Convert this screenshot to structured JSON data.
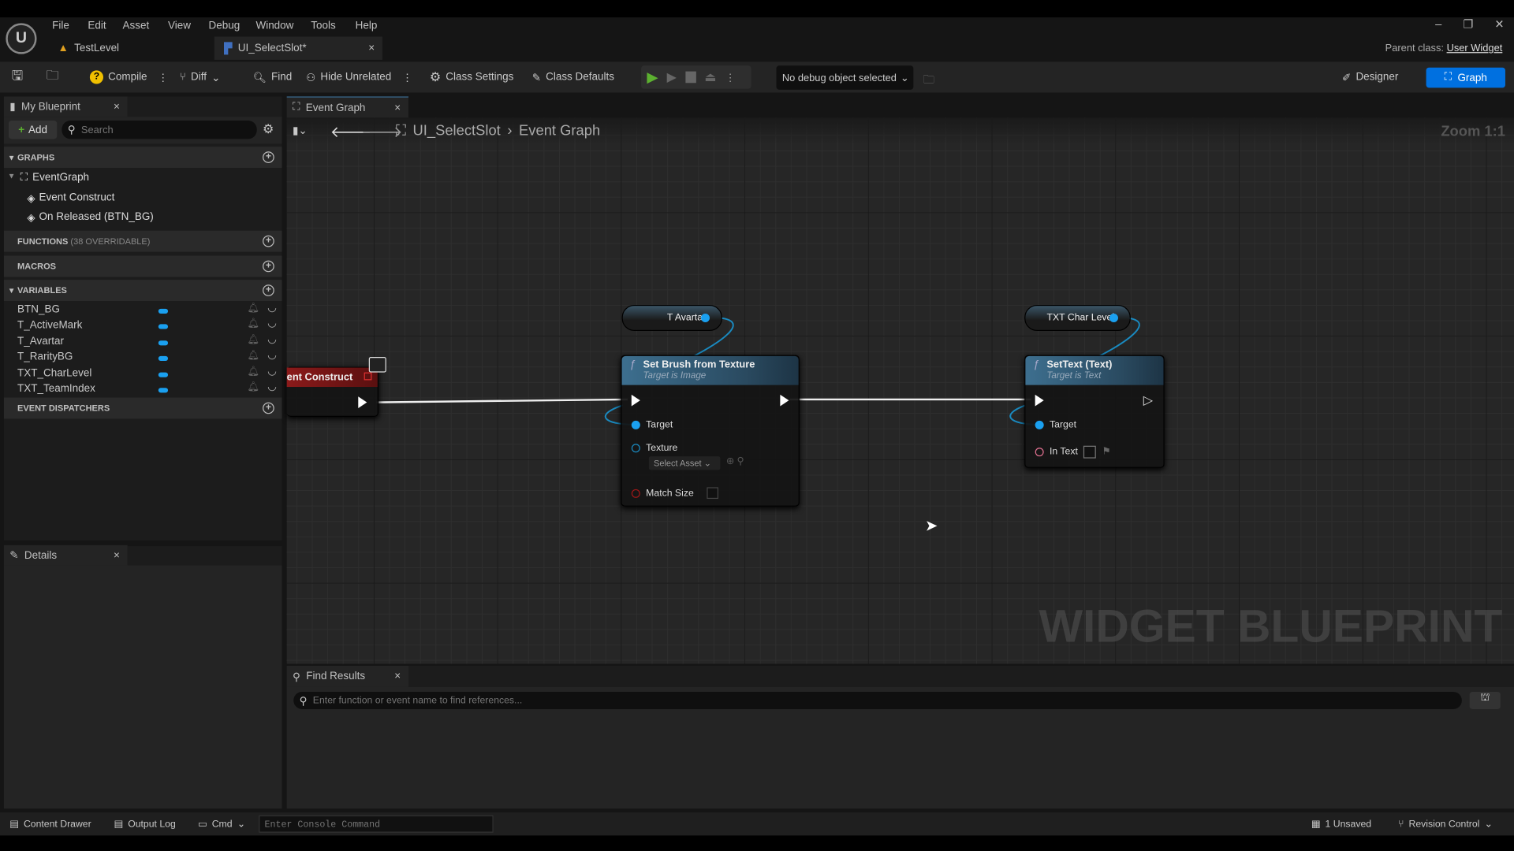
{
  "menu": [
    "File",
    "Edit",
    "Asset",
    "View",
    "Debug",
    "Window",
    "Tools",
    "Help"
  ],
  "doc_tabs": [
    {
      "label": "TestLevel"
    },
    {
      "label": "UI_SelectSlot*"
    }
  ],
  "parent_class": {
    "label": "Parent class:",
    "value": "User Widget"
  },
  "toolbar": {
    "compile": "Compile",
    "diff": "Diff",
    "find": "Find",
    "hide_unrelated": "Hide Unrelated",
    "class_settings": "Class Settings",
    "class_defaults": "Class Defaults",
    "debug_object": "No debug object selected",
    "designer": "Designer",
    "graph": "Graph"
  },
  "my_blueprint": {
    "tab": "My Blueprint",
    "add": "Add",
    "search_placeholder": "Search",
    "graphs": "GRAPHS",
    "event_graph": "EventGraph",
    "events": [
      "Event Construct",
      "On Released (BTN_BG)"
    ],
    "functions": "FUNCTIONS",
    "functions_note": "(38 OVERRIDABLE)",
    "macros": "MACROS",
    "variables": "VARIABLES",
    "variable_items": [
      "BTN_BG",
      "T_ActiveMark",
      "T_Avartar",
      "T_RarityBG",
      "TXT_CharLevel",
      "TXT_TeamIndex"
    ],
    "event_dispatchers": "EVENT DISPATCHERS"
  },
  "details": {
    "tab": "Details"
  },
  "graph": {
    "tab": "Event Graph",
    "breadcrumb": [
      "UI_SelectSlot",
      "Event Graph"
    ],
    "zoom": "Zoom 1:1",
    "watermark": "WIDGET BLUEPRINT",
    "nodes": {
      "event_construct": "ent Construct",
      "t_avartar": "T Avartar",
      "set_brush": {
        "title": "Set Brush from Texture",
        "subtitle": "Target is Image",
        "target": "Target",
        "texture": "Texture",
        "select_asset": "Select Asset",
        "match_size": "Match Size"
      },
      "txt_char_level": "TXT Char Level",
      "set_text": {
        "title": "SetText (Text)",
        "subtitle": "Target is Text",
        "target": "Target",
        "in_text": "In Text"
      }
    }
  },
  "find_results": {
    "tab": "Find Results",
    "placeholder": "Enter function or event name to find references..."
  },
  "status_bar": {
    "content_drawer": "Content Drawer",
    "output_log": "Output Log",
    "cmd": "Cmd",
    "console_placeholder": "Enter Console Command",
    "unsaved": "1 Unsaved",
    "revision_control": "Revision Control"
  },
  "colors": {
    "accent": "#0070e0",
    "object_pin": "#1aa0f0",
    "event_node": "#8b1a1a",
    "function_header": "#3d6f8f"
  }
}
